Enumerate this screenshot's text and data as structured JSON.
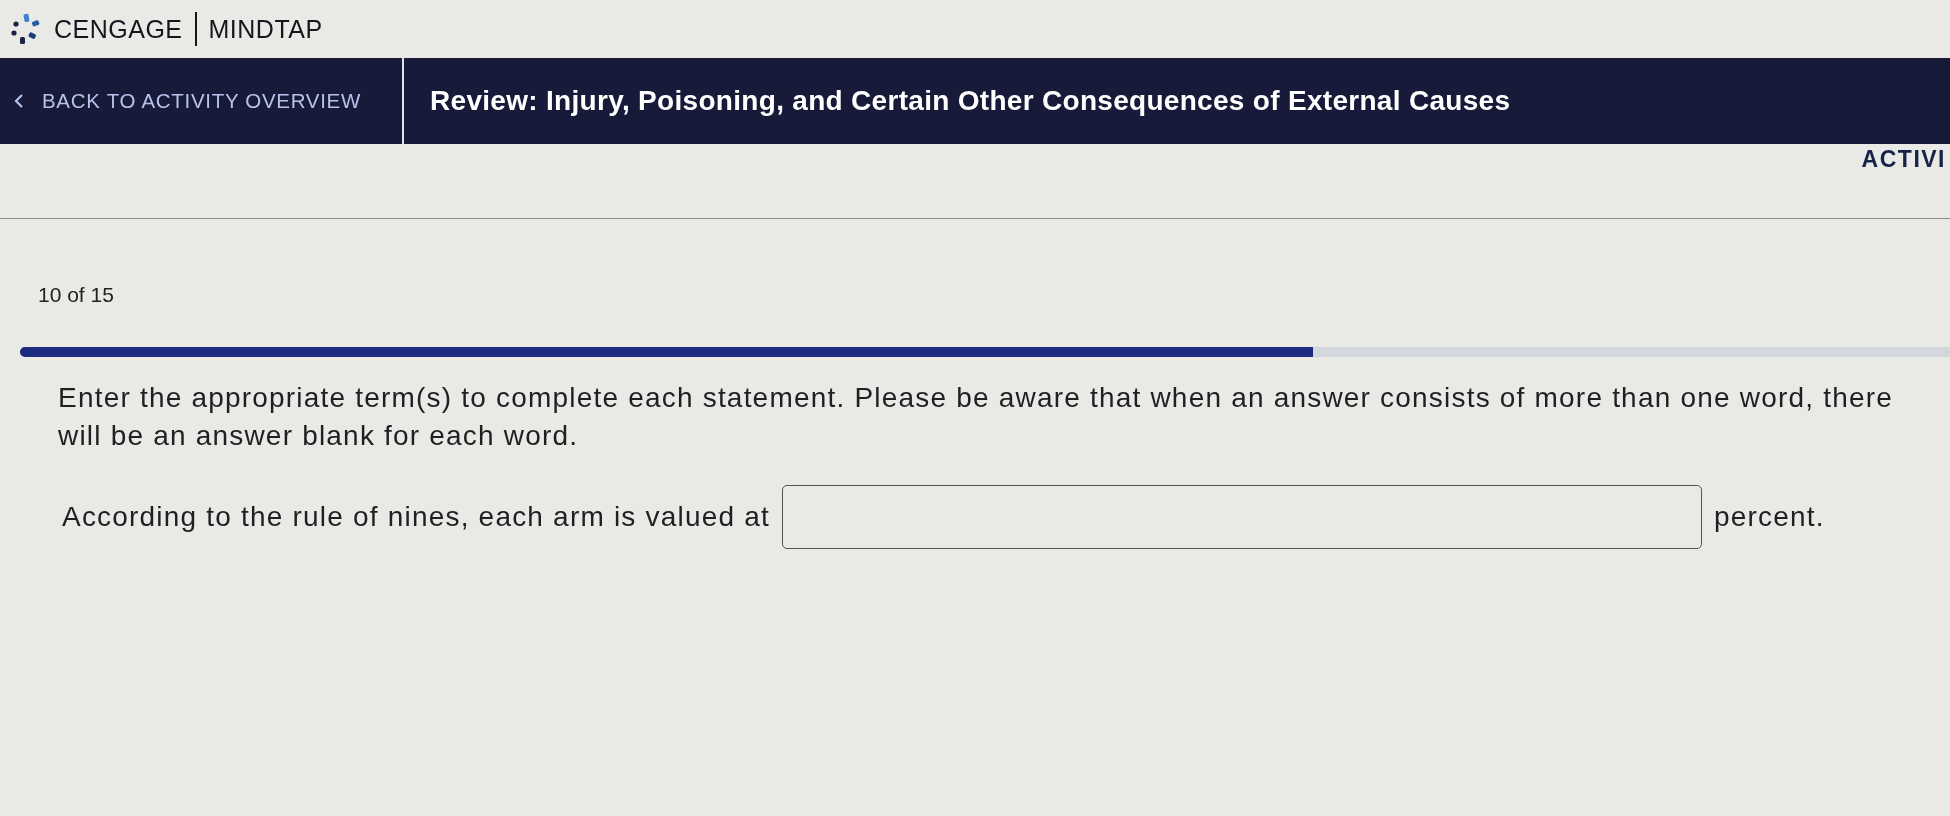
{
  "brand": {
    "company": "CENGAGE",
    "product": "MINDTAP"
  },
  "nav": {
    "back_link": "BACK TO ACTIVITY OVERVIEW",
    "title": "Review: Injury, Poisoning, and Certain Other Consequences of External Causes"
  },
  "activity_tab": "ACTIVI",
  "progress": {
    "label": "10 of 15",
    "level": 0.67
  },
  "instructions": "Enter the appropriate term(s) to complete each statement. Please be aware that when an answer consists of more than one word, there will be an answer blank for each word.",
  "question": {
    "prompt": "According to the rule of nines, each arm is valued at",
    "suffix": "percent."
  }
}
